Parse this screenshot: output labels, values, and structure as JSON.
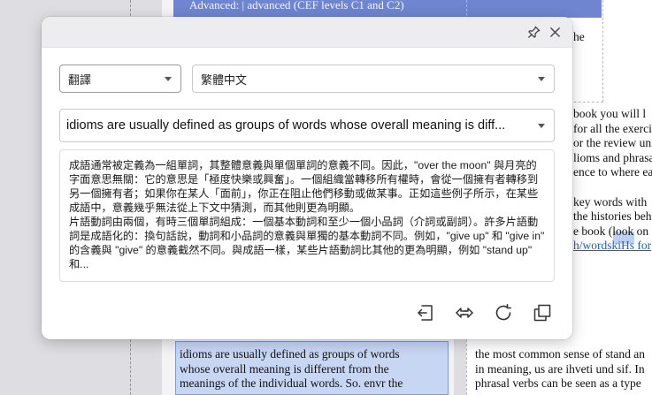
{
  "background_doc": {
    "banner_text": "Advanced:        | advanced (CEF levels C1 and C2)",
    "right_column_top": [
      "he"
    ],
    "right_column_mid": [
      "book you will l",
      "for all the exercis",
      "or the review uni",
      "lioms and phrasal",
      "ence to where ea",
      "",
      "key words with",
      "the histories beh",
      "e book (look on",
      "h/wordskiHs for"
    ],
    "left_column_bottom": [
      "idioms are usually defined as groups of words",
      "whose overall meaning is different from the",
      "meanings of the individual words. So. envr the"
    ],
    "right_column_bottom": [
      "the most common sense of stand an",
      "in meaning, us are ihveti und sif. In",
      "phrasal verbs can be seen as a type"
    ]
  },
  "popup": {
    "pin_icon": "pin-icon",
    "close_icon": "close-icon",
    "mode_select": "翻譯",
    "language_select": "繁體中文",
    "source_text": "idioms are usually defined as groups of words whose overall meaning is diff...",
    "result_paragraphs": [
      "成語通常被定義為一組單詞，其整體意義與單個單詞的意義不同。因此，\"over the moon\" 與月亮的字面意思無關：它的意思是「極度快樂或興奮」。一個組織當轉移所有權時，會從一個擁有者轉移到另一個擁有者；如果你在某人「面前」，你正在阻止他們移動或做某事。正如這些例子所示，在某些成語中，意義幾乎無法從上下文中猜測，而其他則更為明顯。",
      "片語動詞由兩個，有時三個單詞組成：一個基本動詞和至少一個小品詞（介詞或副詞）。許多片語動詞是成語化的：換句話說，動詞和小品詞的意義與單獨的基本動詞不同。例如，\"give up\" 和 \"give in\" 的含義與 \"give\" 的意義截然不同。與成語一樣，某些片語動詞比其他的更為明顯，例如 \"stand up\" 和..."
    ],
    "actions": [
      "undo-icon",
      "swap-icon",
      "refresh-icon",
      "copy-icon"
    ]
  }
}
